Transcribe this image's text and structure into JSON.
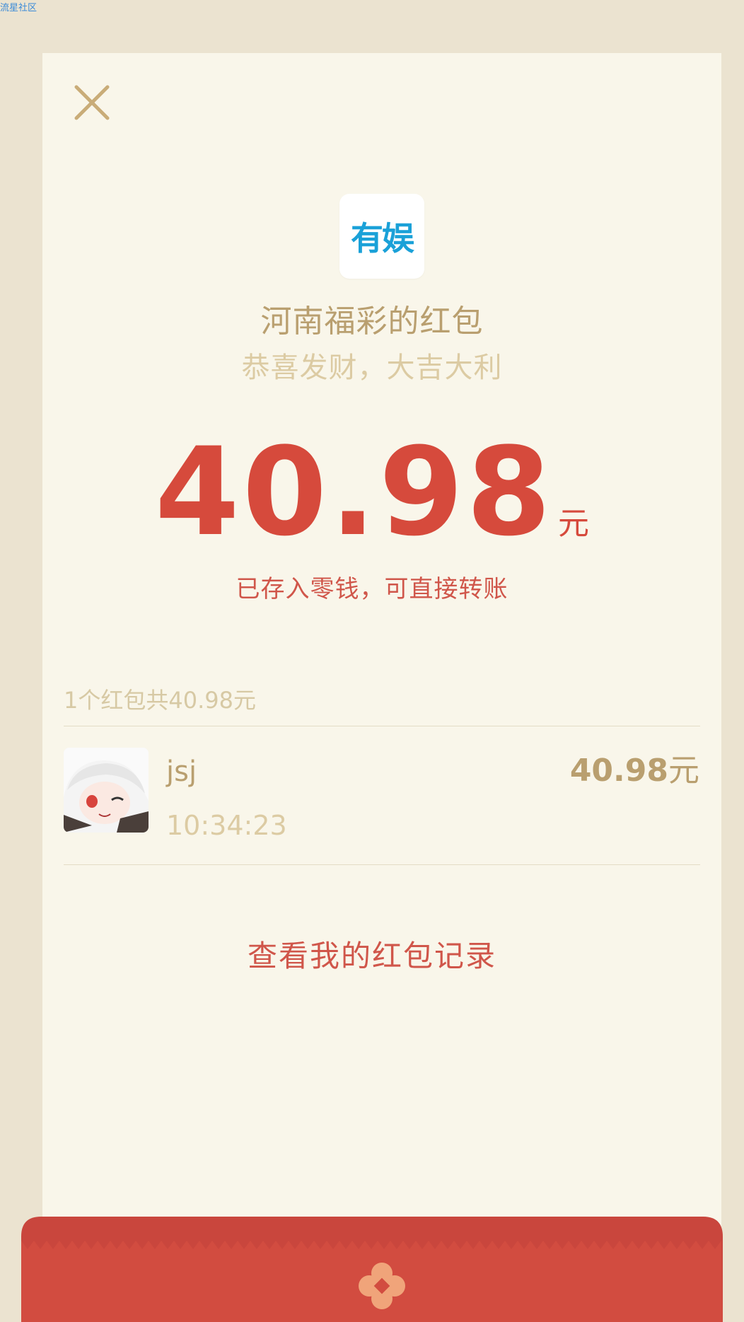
{
  "watermark": "流星社区",
  "header": {
    "sender_name": "河南福彩的红包",
    "greeting": "恭喜发财，大吉大利",
    "logo_text": "有娱"
  },
  "amount": {
    "value": "40.98",
    "unit": "元",
    "saved_text": "已存入零钱，可直接转账"
  },
  "summary": "1个红包共40.98元",
  "recipients": [
    {
      "name": "jsj",
      "time": "10:34:23",
      "amount": "40.98",
      "unit": "元"
    }
  ],
  "records_link": "查看我的红包记录",
  "colors": {
    "accent_red": "#d64a3c",
    "gold_text": "#b99f6f",
    "muted_text": "#dccba3",
    "card_bg": "#f9f6ea",
    "page_bg": "#ebe3d0",
    "logo_blue": "#1aa1d8"
  },
  "icons": {
    "close": "close-icon",
    "footer_emblem": "flower-emblem-icon"
  }
}
